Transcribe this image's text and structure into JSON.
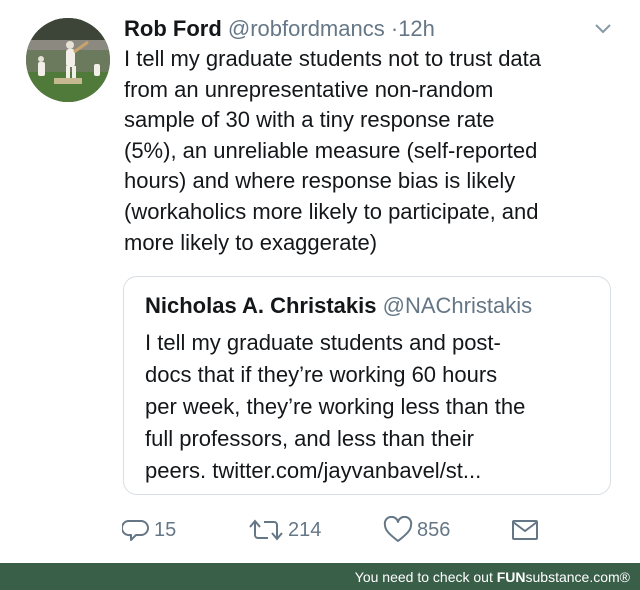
{
  "tweet": {
    "author_name": "Rob Ford",
    "author_handle": "@robfordmancs",
    "separator": "·",
    "time": "12h",
    "text_lines": [
      "I tell my graduate students not to trust data",
      "from an unrepresentative non-random",
      "sample of 30 with a tiny response rate",
      "(5%), an unreliable measure (self-reported",
      "hours) and where response bias is likely",
      "(workaholics more likely to participate, and",
      "more likely to exaggerate)"
    ]
  },
  "quoted_tweet": {
    "author_name": "Nicholas A. Christakis",
    "author_handle": "@NAChristakis",
    "text_lines": [
      "I tell my graduate students and post-",
      "docs that if they’re working 60 hours",
      "per week, they’re working less than the",
      "full professors, and less than their",
      "peers. twitter.com/jayvanbavel/st..."
    ]
  },
  "actions": {
    "replies": "15",
    "retweets": "214",
    "likes": "856"
  },
  "icons": {
    "reply": "reply-icon",
    "retweet": "retweet-icon",
    "like": "heart-icon",
    "message": "envelope-icon",
    "menu": "chevron-down-icon"
  },
  "footer": {
    "prefix": "You need to check out ",
    "brand_bold": "FUN",
    "brand_rest": "substance.com®"
  },
  "colors": {
    "text": "#14171a",
    "muted": "#657786",
    "border": "#d8dee3",
    "footer_bg": "#3a5f49"
  }
}
